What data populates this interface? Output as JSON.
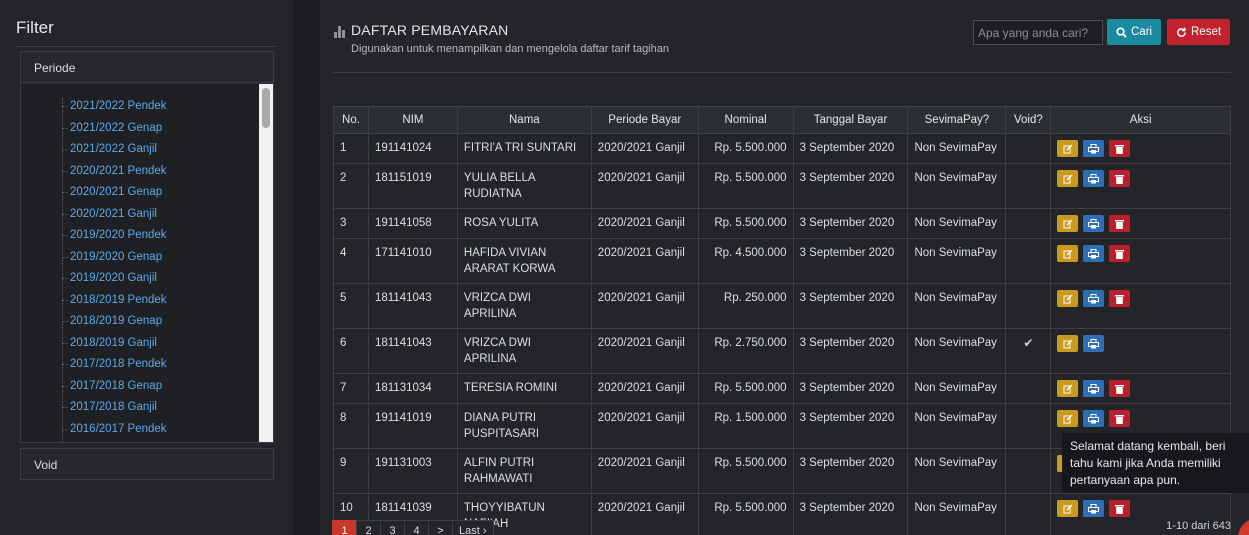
{
  "sidebar": {
    "title": "Filter",
    "periode_label": "Periode",
    "periode_items": [
      "2021/2022 Pendek",
      "2021/2022 Genap",
      "2021/2022 Ganjil",
      "2020/2021 Pendek",
      "2020/2021 Genap",
      "2020/2021 Ganjil",
      "2019/2020 Pendek",
      "2019/2020 Genap",
      "2019/2020 Ganjil",
      "2018/2019 Pendek",
      "2018/2019 Genap",
      "2018/2019 Ganjil",
      "2017/2018 Pendek",
      "2017/2018 Genap",
      "2017/2018 Ganjil",
      "2016/2017 Pendek"
    ],
    "void_label": "Void"
  },
  "header": {
    "title": "DAFTAR PEMBAYARAN",
    "subtitle": "Digunakan untuk menampilkan dan mengelola daftar tarif tagihan"
  },
  "search": {
    "placeholder": "Apa yang anda cari?",
    "value": "",
    "search_label": "Cari",
    "reset_label": "Reset"
  },
  "table": {
    "columns": [
      "No.",
      "NIM",
      "Nama",
      "Periode Bayar",
      "Nominal",
      "Tanggal Bayar",
      "SevimaPay?",
      "Void?",
      "Aksi"
    ],
    "rows": [
      {
        "no": "1",
        "nim": "191141024",
        "nama": "FITRI'A TRI SUNTARI",
        "periode": "2020/2021 Ganjil",
        "nominal": "Rp. 5.500.000",
        "tanggal": "3 September 2020",
        "sevima": "Non SevimaPay",
        "void": false
      },
      {
        "no": "2",
        "nim": "181151019",
        "nama": "YULIA BELLA RUDIATNA",
        "periode": "2020/2021 Ganjil",
        "nominal": "Rp. 5.500.000",
        "tanggal": "3 September 2020",
        "sevima": "Non SevimaPay",
        "void": false
      },
      {
        "no": "3",
        "nim": "191141058",
        "nama": "ROSA YULITA",
        "periode": "2020/2021 Ganjil",
        "nominal": "Rp. 5.500.000",
        "tanggal": "3 September 2020",
        "sevima": "Non SevimaPay",
        "void": false
      },
      {
        "no": "4",
        "nim": "171141010",
        "nama": "HAFIDA VIVIAN ARARAT KORWA",
        "periode": "2020/2021 Ganjil",
        "nominal": "Rp. 4.500.000",
        "tanggal": "3 September 2020",
        "sevima": "Non SevimaPay",
        "void": false
      },
      {
        "no": "5",
        "nim": "181141043",
        "nama": "VRIZCA DWI APRILINA",
        "periode": "2020/2021 Ganjil",
        "nominal": "Rp. 250.000",
        "tanggal": "3 September 2020",
        "sevima": "Non SevimaPay",
        "void": false
      },
      {
        "no": "6",
        "nim": "181141043",
        "nama": "VRIZCA DWI APRILINA",
        "periode": "2020/2021 Ganjil",
        "nominal": "Rp. 2.750.000",
        "tanggal": "3 September 2020",
        "sevima": "Non SevimaPay",
        "void": true
      },
      {
        "no": "7",
        "nim": "181131034",
        "nama": "TERESIA ROMINI",
        "periode": "2020/2021 Ganjil",
        "nominal": "Rp. 5.500.000",
        "tanggal": "3 September 2020",
        "sevima": "Non SevimaPay",
        "void": false
      },
      {
        "no": "8",
        "nim": "191141019",
        "nama": "DIANA PUTRI PUSPITASARI",
        "periode": "2020/2021 Ganjil",
        "nominal": "Rp. 1.500.000",
        "tanggal": "3 September 2020",
        "sevima": "Non SevimaPay",
        "void": false
      },
      {
        "no": "9",
        "nim": "191131003",
        "nama": "ALFIN PUTRI RAHMAWATI",
        "periode": "2020/2021 Ganjil",
        "nominal": "Rp. 5.500.000",
        "tanggal": "3 September 2020",
        "sevima": "Non SevimaPay",
        "void": false
      },
      {
        "no": "10",
        "nim": "181141039",
        "nama": "THOYYIBATUN NAFI'AH",
        "periode": "2020/2021 Ganjil",
        "nominal": "Rp. 5.500.000",
        "tanggal": "3 September 2020",
        "sevima": "Non SevimaPay",
        "void": false
      }
    ]
  },
  "pagination": {
    "pages": [
      "1",
      "2",
      "3",
      "4",
      ">",
      "Last ›"
    ],
    "active": "1",
    "summary": "1-10 dari 643"
  },
  "tooltip": {
    "text": "Selamat datang kembali, beri tahu kami jika Anda memiliki pertanyaan apa pun."
  },
  "colors": {
    "accent_search": "#1a8aa0",
    "accent_reset": "#c0232d",
    "link": "#5fa8e8",
    "edit": "#c99a1e",
    "print": "#2d6fb4",
    "delete": "#b9202a",
    "active_page": "#c9372c"
  },
  "icons": {
    "title": "bar-chart-icon",
    "search": "search-icon",
    "reset": "refresh-icon",
    "edit": "edit-icon",
    "print": "print-icon",
    "delete": "trash-icon",
    "void": "check-icon"
  }
}
